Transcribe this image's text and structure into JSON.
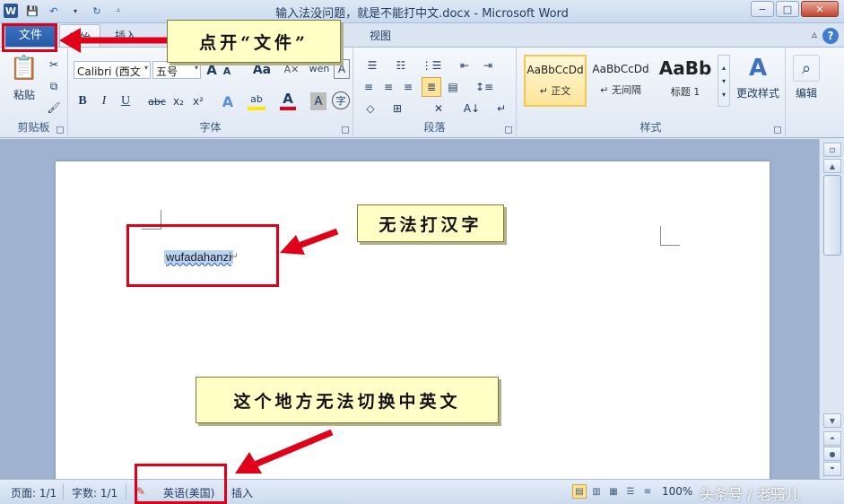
{
  "window": {
    "title": "输入法没问题，就是不能打中文.docx - Microsoft Word",
    "min_label": "−",
    "max_label": "□",
    "close_label": "✕"
  },
  "tabs": {
    "file": "文件",
    "home": "开始",
    "insert": "插入",
    "view": "视图"
  },
  "ribbon": {
    "clipboard": {
      "paste": "粘贴",
      "label": "剪贴板"
    },
    "font": {
      "name": "Calibri (西文",
      "size": "五号",
      "label": "字体",
      "grow": "A",
      "shrink": "A",
      "case": "Aa",
      "bold": "B",
      "italic": "I",
      "underline": "U",
      "strike": "abc",
      "sub": "x₂",
      "sup": "x²",
      "color_a": "A",
      "highlight": "ab",
      "char_border": "A",
      "enclose": "字"
    },
    "paragraph": {
      "label": "段落"
    },
    "styles": {
      "label": "样式",
      "items": [
        {
          "sample": "AaBbCcDd",
          "name": "↵ 正文"
        },
        {
          "sample": "AaBbCcDd",
          "name": "↵ 无间隔"
        },
        {
          "sample": "AaBb",
          "name": "标题 1"
        }
      ],
      "change": "更改样式"
    },
    "edit": {
      "label": "编辑"
    }
  },
  "document": {
    "text": "wufadahanzi",
    "para_mark": "↵"
  },
  "status": {
    "page": "页面: 1/1",
    "words": "字数: 1/1",
    "language": "英语(美国)",
    "mode": "插入",
    "zoom": "100%"
  },
  "annotations": {
    "open_file": "点开“文件”",
    "no_hanzi": "无法打汉字",
    "no_switch": "这个地方无法切换中英文"
  },
  "watermark": "头条号 / 老骚儿",
  "colors": {
    "annotation_red": "#e0001a",
    "callout_bg": "#ffffc6",
    "file_tab": "#2b65b5"
  }
}
